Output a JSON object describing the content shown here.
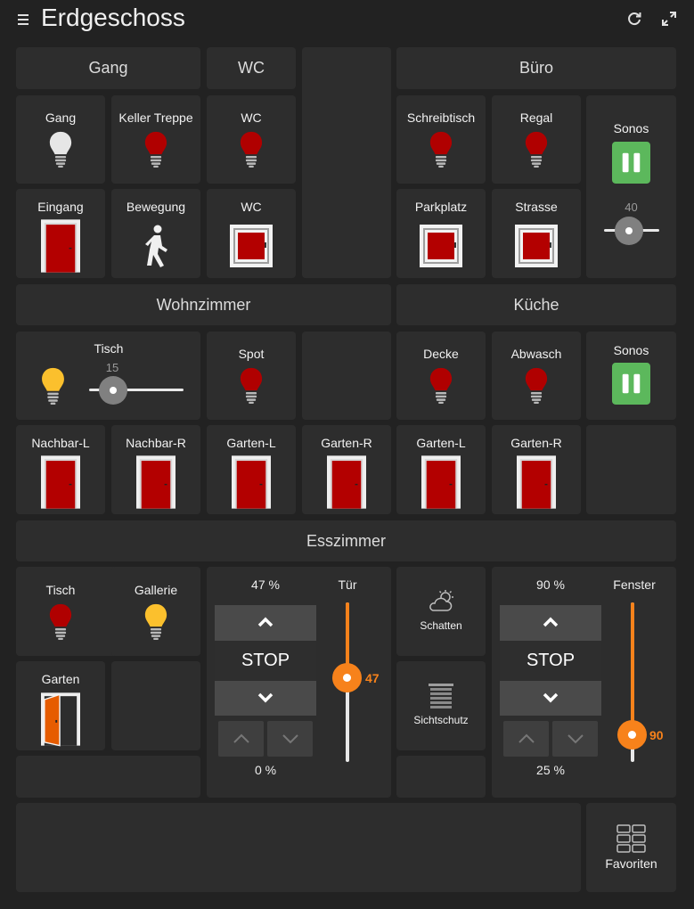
{
  "header": {
    "title": "Erdgeschoss",
    "icons": [
      "menu-icon",
      "refresh-icon",
      "fullscreen-icon"
    ]
  },
  "sections": {
    "gang": "Gang",
    "wc": "WC",
    "buero": "Büro",
    "wohnzimmer": "Wohnzimmer",
    "kueche": "Küche",
    "esszimmer": "Esszimmer"
  },
  "tiles": {
    "gang_light": "Gang",
    "keller_treppe": "Keller Treppe",
    "wc_light": "WC",
    "eingang": "Eingang",
    "bewegung": "Bewegung",
    "wc_window": "WC",
    "schreibtisch": "Schreibtisch",
    "regal": "Regal",
    "parkplatz": "Parkplatz",
    "strasse": "Strasse",
    "sonos_buero": {
      "label": "Sonos",
      "volume": "40",
      "volume_value": 40
    },
    "tisch_wohn": {
      "label": "Tisch",
      "dim": "15",
      "dim_value": 15
    },
    "spot": "Spot",
    "decke": "Decke",
    "abwasch": "Abwasch",
    "sonos_kueche": "Sonos",
    "nachbar_l": "Nachbar-L",
    "nachbar_r": "Nachbar-R",
    "garten_l_wohn": "Garten-L",
    "garten_r_wohn": "Garten-R",
    "garten_l_kueche": "Garten-L",
    "garten_r_kueche": "Garten-R",
    "tisch_ess": "Tisch",
    "gallerie": "Gallerie",
    "garten_ess": "Garten",
    "schatten": "Schatten",
    "sichtschutz": "Sichtschutz",
    "favoriten": "Favoriten"
  },
  "blind_tuer": {
    "top_pct": "47 %",
    "stop": "STOP",
    "bottom_pct": "0 %",
    "slider_label": "Tür",
    "slider_value": "47",
    "level": 47
  },
  "blind_fenster": {
    "top_pct": "90 %",
    "stop": "STOP",
    "bottom_pct": "25 %",
    "slider_label": "Fenster",
    "slider_value": "90",
    "level": 90
  },
  "colors": {
    "background": "#222222",
    "tile": "#2d2d2d",
    "lamp_off": "#b00000",
    "lamp_on": "#fbc02d",
    "accent": "#f7821b",
    "sonos_green": "#5cb85c",
    "door_red": "#b30000"
  }
}
